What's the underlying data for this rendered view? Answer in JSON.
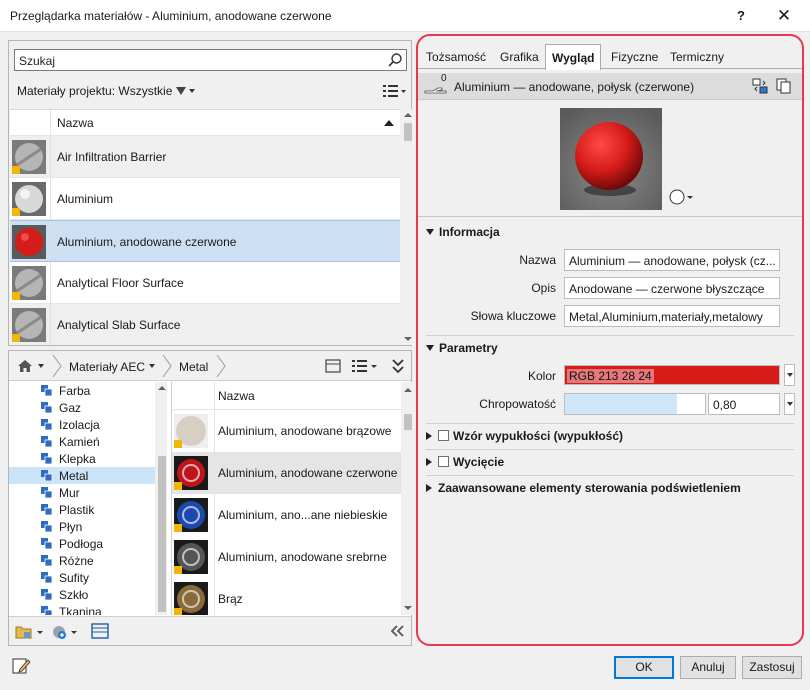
{
  "window": {
    "title": "Przeglądarka materiałów - Aluminium, anodowane czerwone",
    "help_label": "?",
    "close_label": "✕"
  },
  "project": {
    "search_placeholder": "Szukaj",
    "filter_label": "Materiały projektu: Wszystkie",
    "column_name": "Nazwa",
    "materials": [
      {
        "name": "Air Infiltration Barrier",
        "thumb": "gray-crossed-sphere-icon",
        "selected": false
      },
      {
        "name": "Aluminium",
        "thumb": "silver-sphere-icon",
        "selected": false
      },
      {
        "name": "Aluminium, anodowane czerwone",
        "thumb": "red-sphere-icon",
        "selected": true
      },
      {
        "name": "Analytical Floor Surface",
        "thumb": "gray-crossed-sphere-icon",
        "selected": false
      },
      {
        "name": "Analytical Slab Surface",
        "thumb": "gray-crossed-sphere-icon",
        "selected": false
      }
    ]
  },
  "library": {
    "breadcrumb": [
      "Materiały AEC",
      "Metal"
    ],
    "tree": [
      "Farba",
      "Gaz",
      "Izolacja",
      "Kamień",
      "Klepka",
      "Metal",
      "Mur",
      "Plastik",
      "Płyn",
      "Podłoga",
      "Różne",
      "Sufity",
      "Szkło",
      "Tkanina"
    ],
    "tree_selected": "Metal",
    "column_name": "Nazwa",
    "items": [
      {
        "name": "Aluminium, anodowane brązowe",
        "color": "#d8cfc4"
      },
      {
        "name": "Aluminium, anodowane czerwone",
        "color": "#c0141c"
      },
      {
        "name": "Aluminium, ano...ane niebieskie",
        "color": "#1c49b0"
      },
      {
        "name": "Aluminium, anodowane srebrne",
        "color": "#555555"
      },
      {
        "name": "Brąz",
        "color": "#8a6a3a"
      }
    ]
  },
  "editor": {
    "tabs": [
      "Tożsamość",
      "Grafika",
      "Wygląd",
      "Fizyczne",
      "Termiczny"
    ],
    "active_tab": "Wygląd",
    "asset_count": "0",
    "asset_name": "Aluminium — anodowane, połysk (czerwone)",
    "info": {
      "heading": "Informacja",
      "name_label": "Nazwa",
      "name_value": "Aluminium — anodowane, połysk (cz...",
      "desc_label": "Opis",
      "desc_value": "Anodowane — czerwone błyszczące",
      "keywords_label": "Słowa kluczowe",
      "keywords_value": "Metal,Aluminium,materiały,metalowy"
    },
    "params": {
      "heading": "Parametry",
      "color_label": "Kolor",
      "color_value": "RGB 213 28 24",
      "color_hex": "#d51c18",
      "roughness_label": "Chropowatość",
      "roughness_value": "0,80",
      "roughness_fraction": 0.8
    },
    "sections": {
      "bump": "Wzór wypukłości (wypukłość)",
      "cutout": "Wycięcie",
      "advanced": "Zaawansowane elementy sterowania podświetleniem"
    }
  },
  "buttons": {
    "ok": "OK",
    "cancel": "Anuluj",
    "apply": "Zastosuj"
  },
  "colors": {
    "accent_border": "#e8384f",
    "selection": "#cde0f3"
  }
}
